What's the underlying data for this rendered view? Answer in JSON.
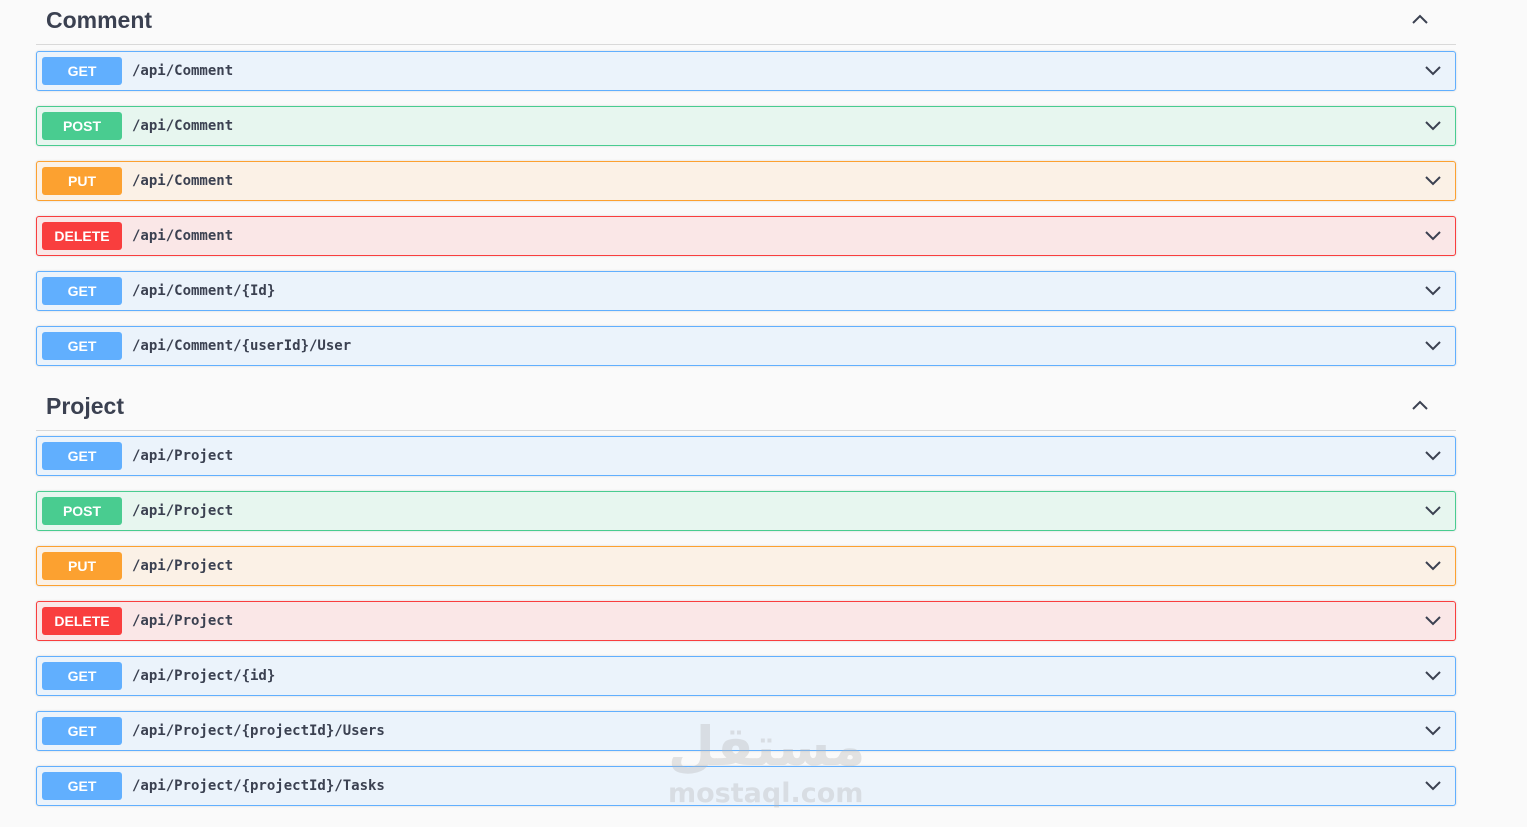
{
  "sections": [
    {
      "title": "Comment",
      "operations": [
        {
          "method": "GET",
          "path": "/api/Comment"
        },
        {
          "method": "POST",
          "path": "/api/Comment"
        },
        {
          "method": "PUT",
          "path": "/api/Comment"
        },
        {
          "method": "DELETE",
          "path": "/api/Comment"
        },
        {
          "method": "GET",
          "path": "/api/Comment/{Id}"
        },
        {
          "method": "GET",
          "path": "/api/Comment/{userId}/User"
        }
      ]
    },
    {
      "title": "Project",
      "operations": [
        {
          "method": "GET",
          "path": "/api/Project"
        },
        {
          "method": "POST",
          "path": "/api/Project"
        },
        {
          "method": "PUT",
          "path": "/api/Project"
        },
        {
          "method": "DELETE",
          "path": "/api/Project"
        },
        {
          "method": "GET",
          "path": "/api/Project/{id}"
        },
        {
          "method": "GET",
          "path": "/api/Project/{projectId}/Users"
        },
        {
          "method": "GET",
          "path": "/api/Project/{projectId}/Tasks"
        }
      ]
    }
  ],
  "watermark": {
    "arabic": "مستقل",
    "latin": "mostaql.com"
  },
  "colors": {
    "get": "#61affe",
    "post": "#49cc90",
    "put": "#fca130",
    "delete": "#f93e3e"
  }
}
